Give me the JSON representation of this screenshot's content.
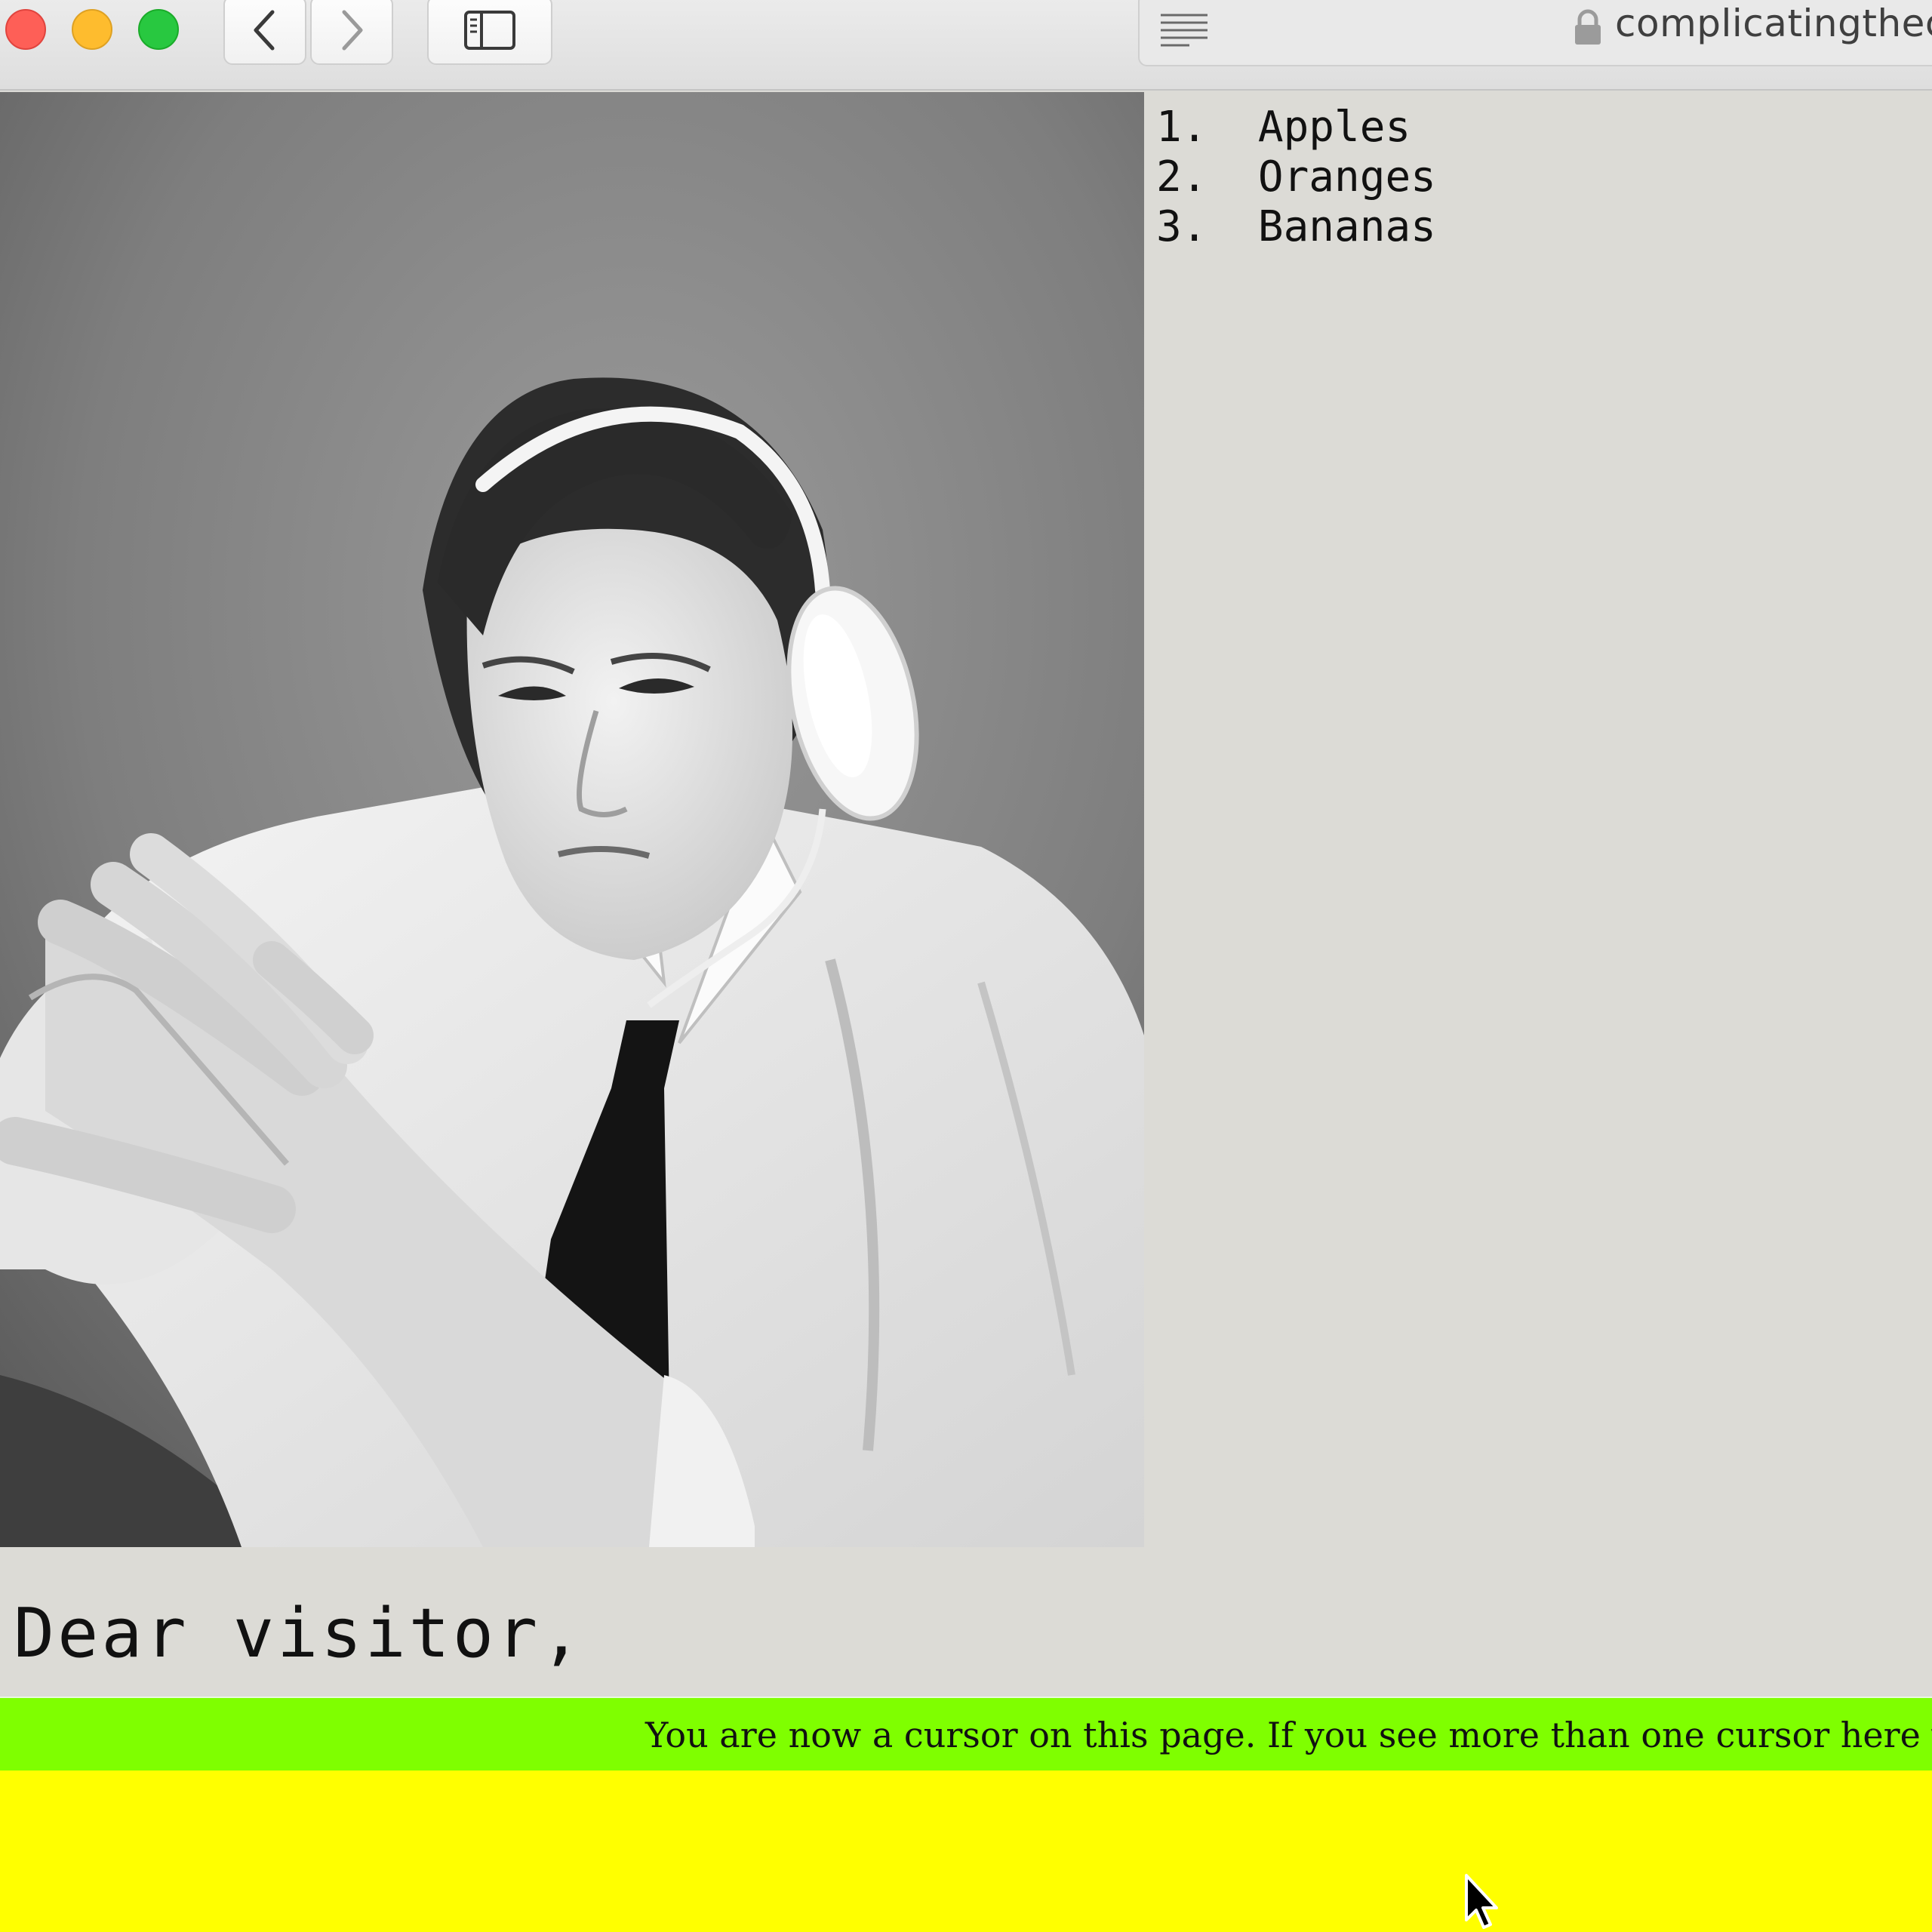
{
  "browser": {
    "url_text": "complicatingthec",
    "icons": {
      "close": "close-window-icon",
      "minimize": "minimize-window-icon",
      "zoom": "zoom-window-icon",
      "back": "chevron-left-icon",
      "forward": "chevron-right-icon",
      "sidebar": "sidebar-icon",
      "reader": "reader-view-icon",
      "lock": "lock-icon"
    },
    "colors": {
      "close": "#fe5f57",
      "minimize": "#febc2e",
      "zoom": "#28c840"
    }
  },
  "page": {
    "fruit_list": [
      {
        "number": "1.",
        "label": "Apples"
      },
      {
        "number": "2.",
        "label": "Oranges"
      },
      {
        "number": "3.",
        "label": "Bananas"
      }
    ],
    "greeting": "Dear visitor,",
    "marquee": "You are now a cursor on this page. If you see more than one cursor here yo",
    "colors": {
      "background": "#dcdbd6",
      "marquee": "#7fff00",
      "cursor_zone": "#ffff00"
    }
  }
}
